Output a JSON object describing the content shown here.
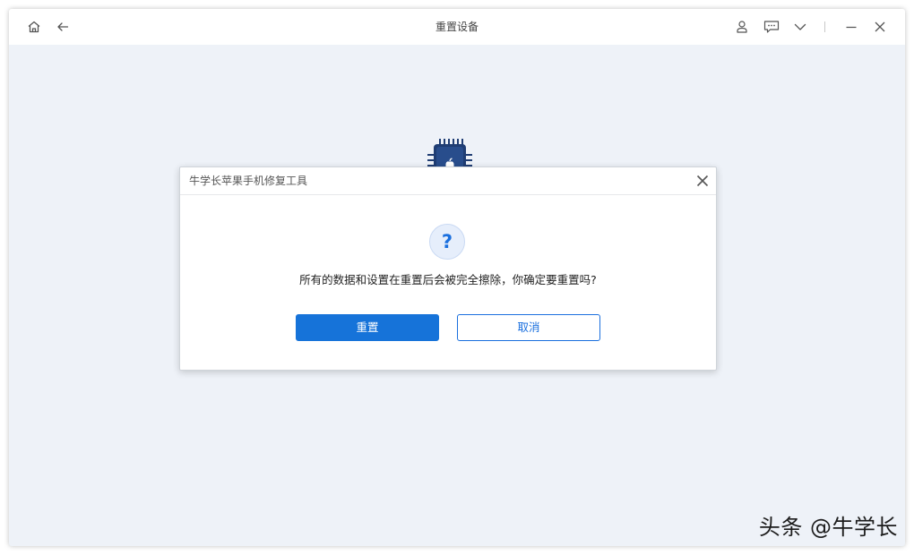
{
  "window": {
    "title": "重置设备",
    "icons": [
      "home-icon",
      "back-arrow-icon",
      "user-icon",
      "feedback-icon",
      "chevron-down-icon",
      "minimize-icon",
      "close-icon"
    ]
  },
  "dialog": {
    "title": "牛学长苹果手机修复工具",
    "message": "所有的数据和设置在重置后会被完全擦除，你确定要重置吗?",
    "question_mark": "?",
    "confirm_label": "重置",
    "cancel_label": "取消"
  },
  "watermark": "头条 @牛学长",
  "colors": {
    "accent": "#1673d9",
    "background": "#eef2f8",
    "chip": "#1f3d73"
  }
}
